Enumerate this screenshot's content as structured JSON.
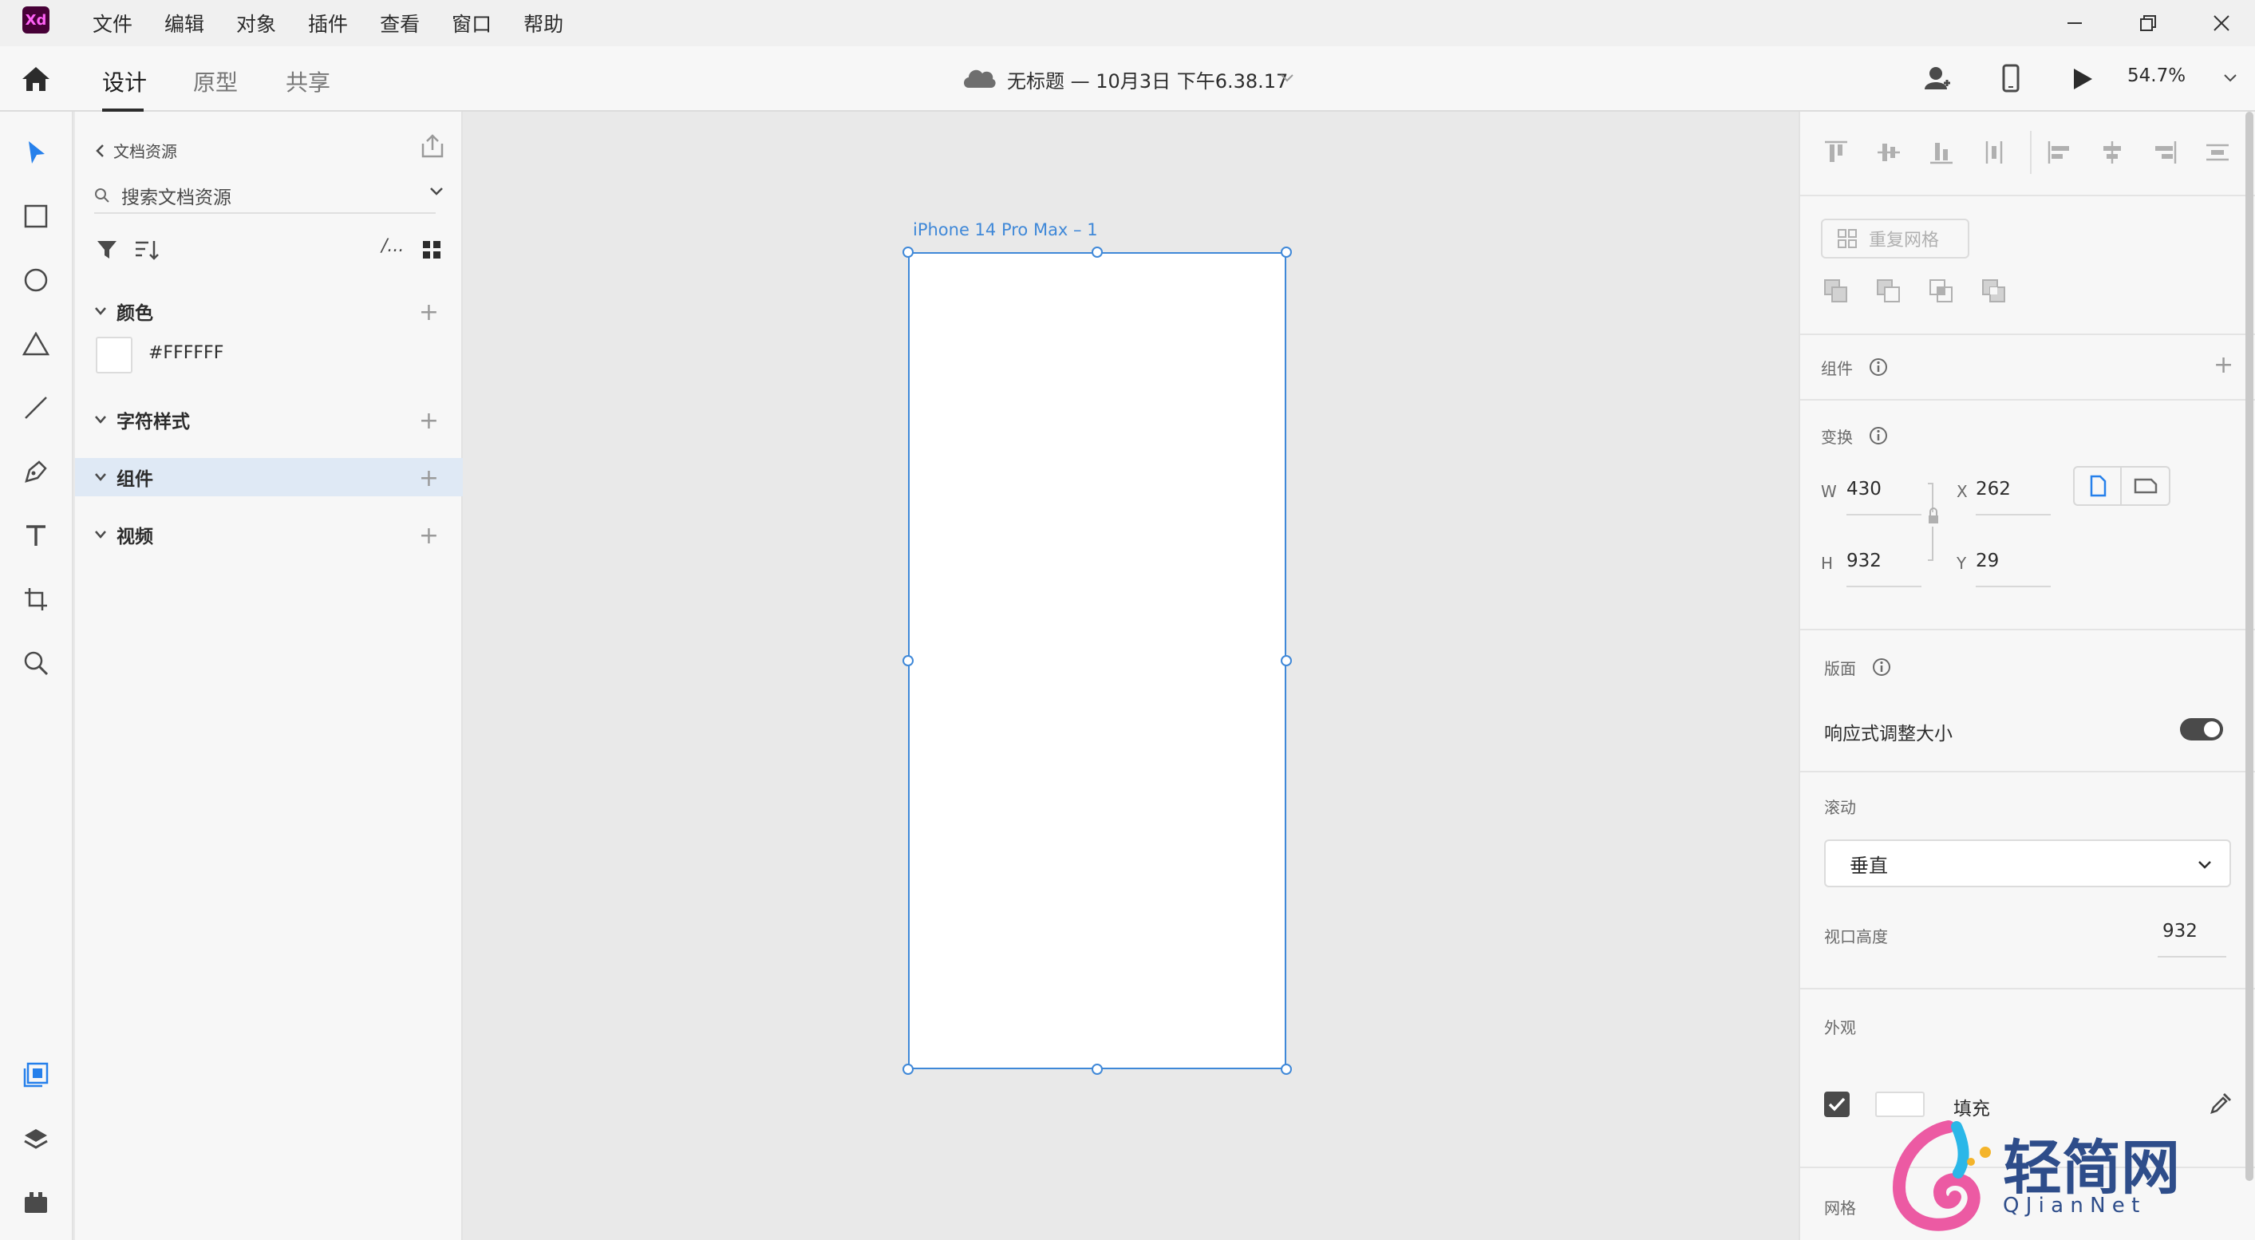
{
  "app": {
    "logo_text": "Xd"
  },
  "menu": [
    "文件",
    "编辑",
    "对象",
    "插件",
    "查看",
    "窗口",
    "帮助"
  ],
  "tabs": {
    "design": "设计",
    "prototype": "原型",
    "share": "共享"
  },
  "document": {
    "title": "无标题 — 10月3日 下午6.38.17"
  },
  "toolbar": {
    "zoom": "54.7%"
  },
  "assets": {
    "back_label": "文档资源",
    "search_placeholder": "搜索文档资源",
    "view_label": "/...",
    "sections": {
      "colors": "颜色",
      "char_styles": "字符样式",
      "components": "组件",
      "video": "视频"
    },
    "color_swatch": {
      "hex": "#FFFFFF"
    }
  },
  "artboard": {
    "name": "iPhone 14 Pro Max – 1"
  },
  "props": {
    "repeat_grid": "重复网格",
    "component_label": "组件",
    "transform_label": "变换",
    "w_label": "W",
    "w": "430",
    "h_label": "H",
    "h": "932",
    "x_label": "X",
    "x": "262",
    "y_label": "Y",
    "y": "29",
    "layout_label": "版面",
    "responsive_label": "响应式调整大小",
    "scroll_label": "滚动",
    "scroll_value": "垂直",
    "viewport_label": "视口高度",
    "viewport_value": "932",
    "appearance_label": "外观",
    "fill_label": "填充",
    "grid_label": "网格"
  },
  "watermark": {
    "cn": "轻简网",
    "en": "Q J i a n N e t"
  },
  "colors": {
    "accent": "#3f88d8",
    "selection": "#dfe9f5",
    "brand_bg": "#470137",
    "brand_fg": "#ff61f6"
  }
}
